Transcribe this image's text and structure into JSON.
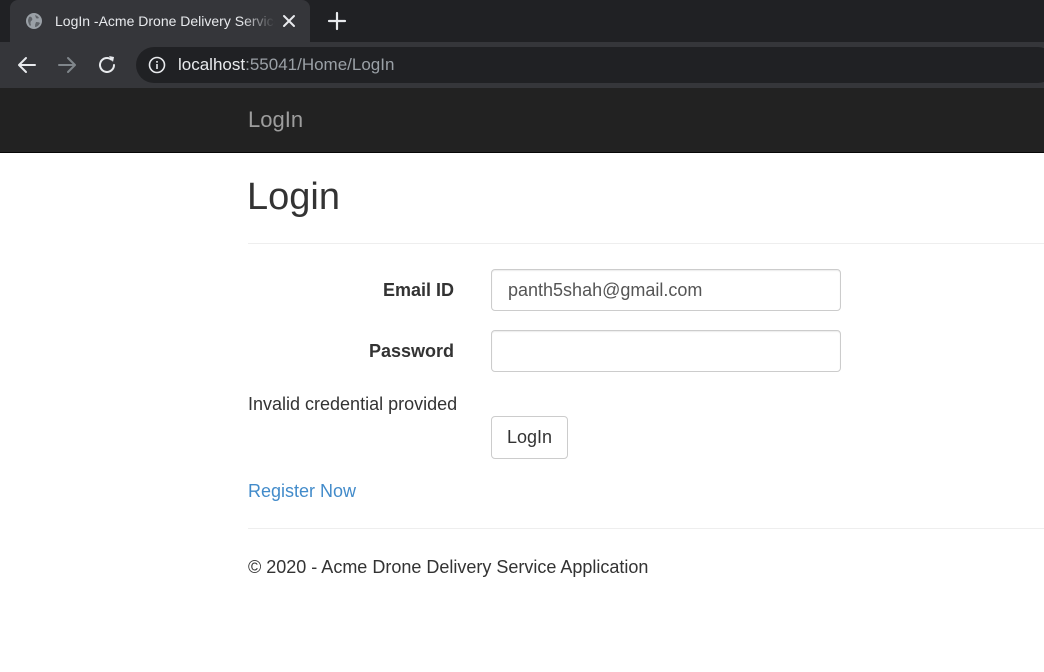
{
  "browser": {
    "tab_title": "LogIn -Acme Drone Delivery Service Application",
    "url_host": "localhost",
    "url_rest": ":55041/Home/LogIn"
  },
  "app": {
    "brand": "LogIn"
  },
  "login": {
    "heading": "Login",
    "email_label": "Email ID",
    "email_value": "panth5shah@gmail.com",
    "password_label": "Password",
    "password_value": "",
    "error_message": "Invalid credential provided",
    "submit_label": "LogIn",
    "register_link": "Register Now"
  },
  "footer": {
    "text": "© 2020 - Acme Drone Delivery Service Application"
  },
  "colors": {
    "navbar_bg": "#222222",
    "brand_text": "#9d9d9d",
    "link": "#428bca",
    "text": "#333333"
  },
  "icons": [
    "globe-icon",
    "close-icon",
    "plus-icon",
    "back-arrow-icon",
    "forward-arrow-icon",
    "reload-icon",
    "info-icon"
  ]
}
